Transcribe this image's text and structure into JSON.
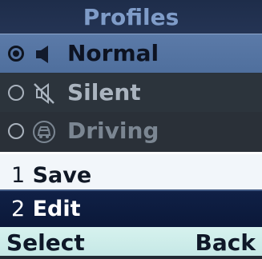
{
  "title": "Profiles",
  "profiles": [
    {
      "label": "Normal",
      "selected": true,
      "icon": "speaker-icon"
    },
    {
      "label": "Silent",
      "selected": false,
      "icon": "speaker-muted-icon"
    },
    {
      "label": "Driving",
      "selected": false,
      "icon": "car-icon"
    }
  ],
  "options": [
    {
      "number": "1",
      "label": "Save"
    },
    {
      "number": "2",
      "label": "Edit"
    }
  ],
  "softkeys": {
    "left": "Select",
    "right": "Back"
  }
}
